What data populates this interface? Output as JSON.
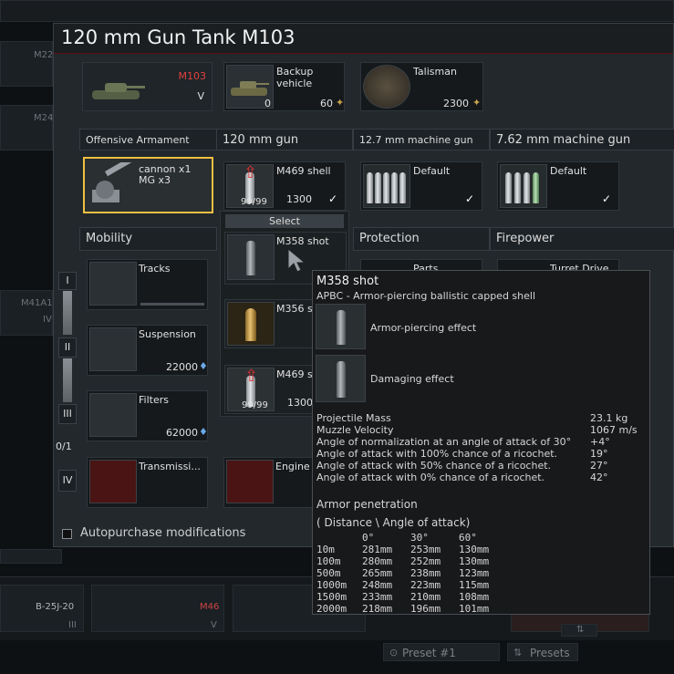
{
  "window": {
    "title": "120 mm Gun Tank M103"
  },
  "background": {
    "left_items": [
      "M22",
      "M24",
      "M41A1",
      "IV"
    ],
    "bottom_items": [
      {
        "name": "B-25J-20",
        "rank": "III"
      },
      {
        "name": "M46",
        "rank": "V"
      }
    ],
    "preset": "Preset #1",
    "presets_button": "Presets"
  },
  "slots": {
    "vehicle": {
      "name": "M103",
      "rank": "V"
    },
    "backup": {
      "label": "Backup vehicle",
      "count": "0",
      "price": "60"
    },
    "talisman": {
      "label": "Talisman",
      "price": "2300"
    }
  },
  "armament": {
    "headers": [
      "Offensive Armament",
      "120 mm gun",
      "12.7 mm machine gun",
      "7.62 mm machine gun"
    ],
    "weapon": {
      "line1": "cannon x1",
      "line2": "MG x3"
    },
    "gun": {
      "shell": "M469 shell",
      "ammo": "99/99",
      "price": "1300"
    },
    "mg127": "Default",
    "mg762": "Default"
  },
  "dropdown": {
    "title": "Select",
    "items": [
      {
        "name": "M358 shot"
      },
      {
        "name": "M356 s"
      },
      {
        "name": "M469 s",
        "ammo": "99/99",
        "price": "1300"
      }
    ]
  },
  "sections": {
    "mobility": "Mobility",
    "protection": "Protection",
    "firepower": "Firepower",
    "parts": "Parts",
    "turret": "Turret Drive"
  },
  "mods": [
    {
      "name": "Tracks"
    },
    {
      "name": "Suspension",
      "price": "22000"
    },
    {
      "name": "Filters",
      "price": "62000"
    },
    {
      "name": "Transmissi..."
    },
    {
      "name": "Engine"
    }
  ],
  "tiers": [
    "I",
    "II",
    "III",
    "0/1",
    "IV"
  ],
  "autopurchase": "Autopurchase modifications",
  "tooltip": {
    "name": "M358 shot",
    "type": "APBC - Armor-piercing ballistic capped shell",
    "effects": [
      "Armor-piercing effect",
      "Damaging effect"
    ],
    "stats": [
      {
        "label": "Projectile Mass",
        "value": "23.1 kg"
      },
      {
        "label": "Muzzle Velocity",
        "value": "1067 m/s"
      },
      {
        "label": "Angle of normalization at an angle of attack of 30°",
        "value": "+4°"
      },
      {
        "label": "Angle of attack with 100% chance of a ricochet.",
        "value": "19°"
      },
      {
        "label": "Angle of attack with 50% chance of a ricochet.",
        "value": "27°"
      },
      {
        "label": "Angle of attack with 0% chance of a ricochet.",
        "value": "42°"
      }
    ],
    "pen_title": "Armor penetration",
    "pen_sub": "( Distance \\ Angle of attack)",
    "pen_head": [
      "0°",
      "30°",
      "60°"
    ],
    "pen_rows": [
      [
        "10m",
        "281mm",
        "253mm",
        "130mm"
      ],
      [
        "100m",
        "280mm",
        "252mm",
        "130mm"
      ],
      [
        "500m",
        "265mm",
        "238mm",
        "123mm"
      ],
      [
        "1000m",
        "248mm",
        "223mm",
        "115mm"
      ],
      [
        "1500m",
        "233mm",
        "210mm",
        "108mm"
      ],
      [
        "2000m",
        "218mm",
        "196mm",
        "101mm"
      ]
    ]
  },
  "colors": {
    "accent_red": "#e03030",
    "highlight": "#f0c040"
  }
}
